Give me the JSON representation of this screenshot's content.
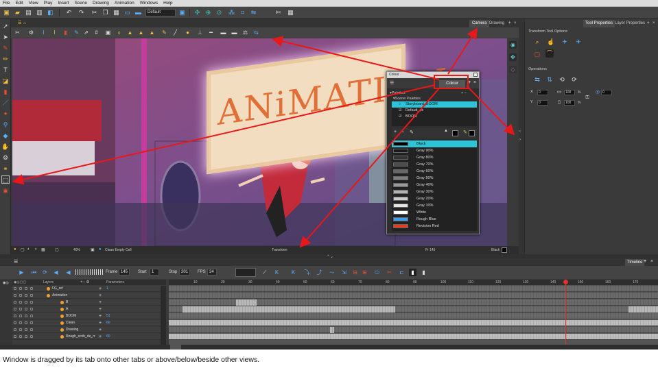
{
  "menu": [
    "File",
    "Edit",
    "View",
    "Play",
    "Insert",
    "Scene",
    "Drawing",
    "Animation",
    "Windows",
    "Help"
  ],
  "toolbar": {
    "preset": "Default"
  },
  "view_tabs": {
    "camera": "Camera",
    "drawing": "Drawing"
  },
  "scene": {
    "sign_text": "ANiMATION"
  },
  "status_bar": {
    "zoom": "40%",
    "clean_empty": "Clean Empty Cell",
    "tool": "Transform",
    "frame": "Fr 145",
    "color": "Black"
  },
  "colour_window": {
    "title": "Colour",
    "tab": "Colour",
    "palettes_label": "Palettes",
    "scene_palettes": "Scene Palettes",
    "palettes": [
      "Storyboard_BOOM",
      "Default_pc",
      "BOOM"
    ],
    "colors": [
      {
        "name": "Black",
        "hex": "#000000"
      },
      {
        "name": "Gray 90%",
        "hex": "#1a1a1a"
      },
      {
        "name": "Gray 80%",
        "hex": "#333333"
      },
      {
        "name": "Gray 70%",
        "hex": "#4d4d4d"
      },
      {
        "name": "Gray 60%",
        "hex": "#666666"
      },
      {
        "name": "Gray 50%",
        "hex": "#808080"
      },
      {
        "name": "Gray 40%",
        "hex": "#999999"
      },
      {
        "name": "Gray 30%",
        "hex": "#b3b3b3"
      },
      {
        "name": "Gray 20%",
        "hex": "#cccccc"
      },
      {
        "name": "Gray 10%",
        "hex": "#e6e6e6"
      },
      {
        "name": "White",
        "hex": "#ffffff"
      },
      {
        "name": "Rough Blue",
        "hex": "#3aa0f0"
      },
      {
        "name": "Revision Red",
        "hex": "#e63c1e"
      }
    ]
  },
  "right_panel": {
    "tab_tool": "Tool Properties",
    "tab_layer": "Layer Properties",
    "tool_options": "Transform Tool Options",
    "operations": "Operations",
    "x_label": "X",
    "x_val": "0",
    "y_label": "Y",
    "y_val": "0",
    "w_val": "100",
    "h_val": "100",
    "angle_val": "0",
    "pct": "%"
  },
  "timeline": {
    "tab": "Timeline",
    "frame_label": "Frame",
    "frame": "145",
    "start_label": "Start",
    "start": "1",
    "stop_label": "Stop",
    "stop": "201",
    "fps_label": "FPS",
    "fps": "24",
    "layers_header": "Layers",
    "params_header": "Parameters",
    "ruler": [
      "10",
      "20",
      "30",
      "40",
      "50",
      "60",
      "70",
      "80",
      "90",
      "100",
      "110",
      "120",
      "130",
      "140",
      "150",
      "160",
      "170"
    ],
    "layers": [
      {
        "name": "FG_ref",
        "param": "1"
      },
      {
        "name": "Animation",
        "param": ""
      },
      {
        "name": "B",
        "param": ""
      },
      {
        "name": "A",
        "param": ""
      },
      {
        "name": "BOOM",
        "param": "51"
      },
      {
        "name": "Clean",
        "param": "60"
      },
      {
        "name": "Drawing",
        "param": ""
      },
      {
        "name": "Rough_scrib_de_rr",
        "param": "60"
      }
    ]
  },
  "caption": "Window is dragged by its tab onto other tabs or above/below/beside other views."
}
